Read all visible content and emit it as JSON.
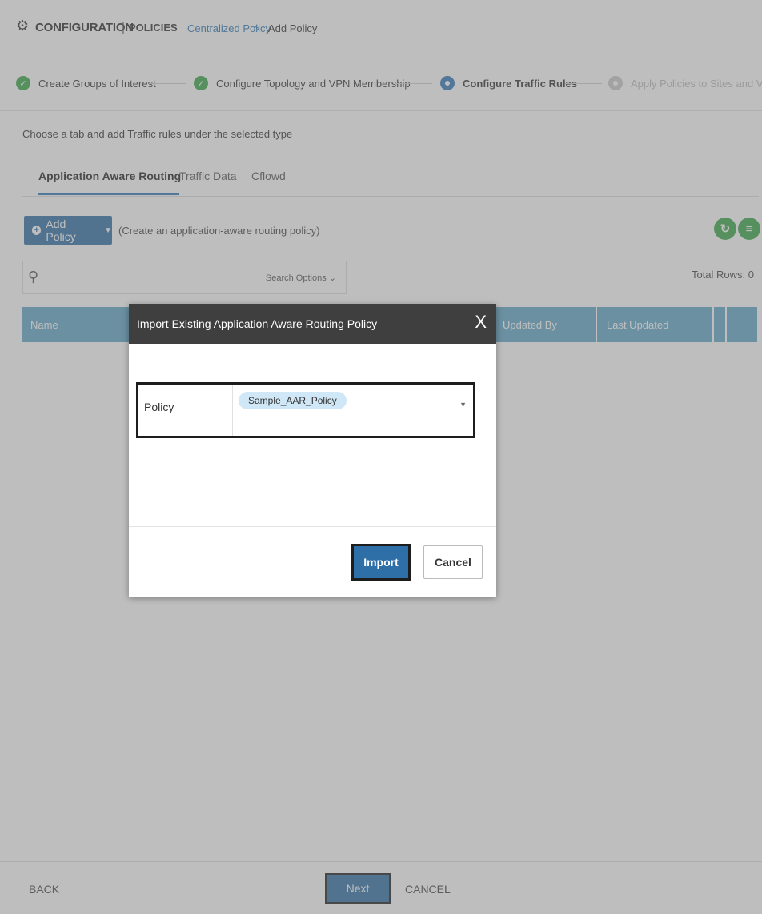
{
  "header": {
    "title": "CONFIGURATION",
    "separator": "|",
    "subtitle": "POLICIES",
    "breadcrumb_link": "Centralized Policy",
    "breadcrumb_arrow": ">",
    "breadcrumb_current": "Add Policy"
  },
  "steps": [
    {
      "label": "Create Groups of Interest",
      "state": "done"
    },
    {
      "label": "Configure Topology and VPN Membership",
      "state": "done"
    },
    {
      "label": "Configure Traffic Rules",
      "state": "active"
    },
    {
      "label": "Apply Policies to Sites and VPN",
      "state": "pending"
    }
  ],
  "instruction": "Choose a tab and add Traffic rules under the selected type",
  "tabs": [
    {
      "label": "Application Aware Routing",
      "active": true
    },
    {
      "label": "Traffic Data",
      "active": false
    },
    {
      "label": "Cflowd",
      "active": false
    }
  ],
  "toolbar": {
    "add_policy_label": "Add Policy",
    "add_policy_hint": "(Create an application-aware routing policy)"
  },
  "search": {
    "placeholder": "",
    "options_label": "Search Options"
  },
  "total_rows": "Total Rows: 0",
  "table": {
    "columns": [
      "Name",
      "Updated By",
      "Last Updated",
      ""
    ]
  },
  "modal": {
    "title": "Import Existing Application Aware Routing Policy",
    "close_glyph": "X",
    "field_label": "Policy",
    "selected_value": "Sample_AAR_Policy",
    "import_label": "Import",
    "cancel_label": "Cancel"
  },
  "footer": {
    "back_label": "BACK",
    "next_label": "Next",
    "cancel_label": "CANCEL"
  },
  "colors": {
    "primary": "#2f6fa8",
    "done_green": "#3aa84a",
    "table_header": "#5ea8c8",
    "modal_header": "#3f3f3f",
    "pill": "#cfe7f6"
  }
}
